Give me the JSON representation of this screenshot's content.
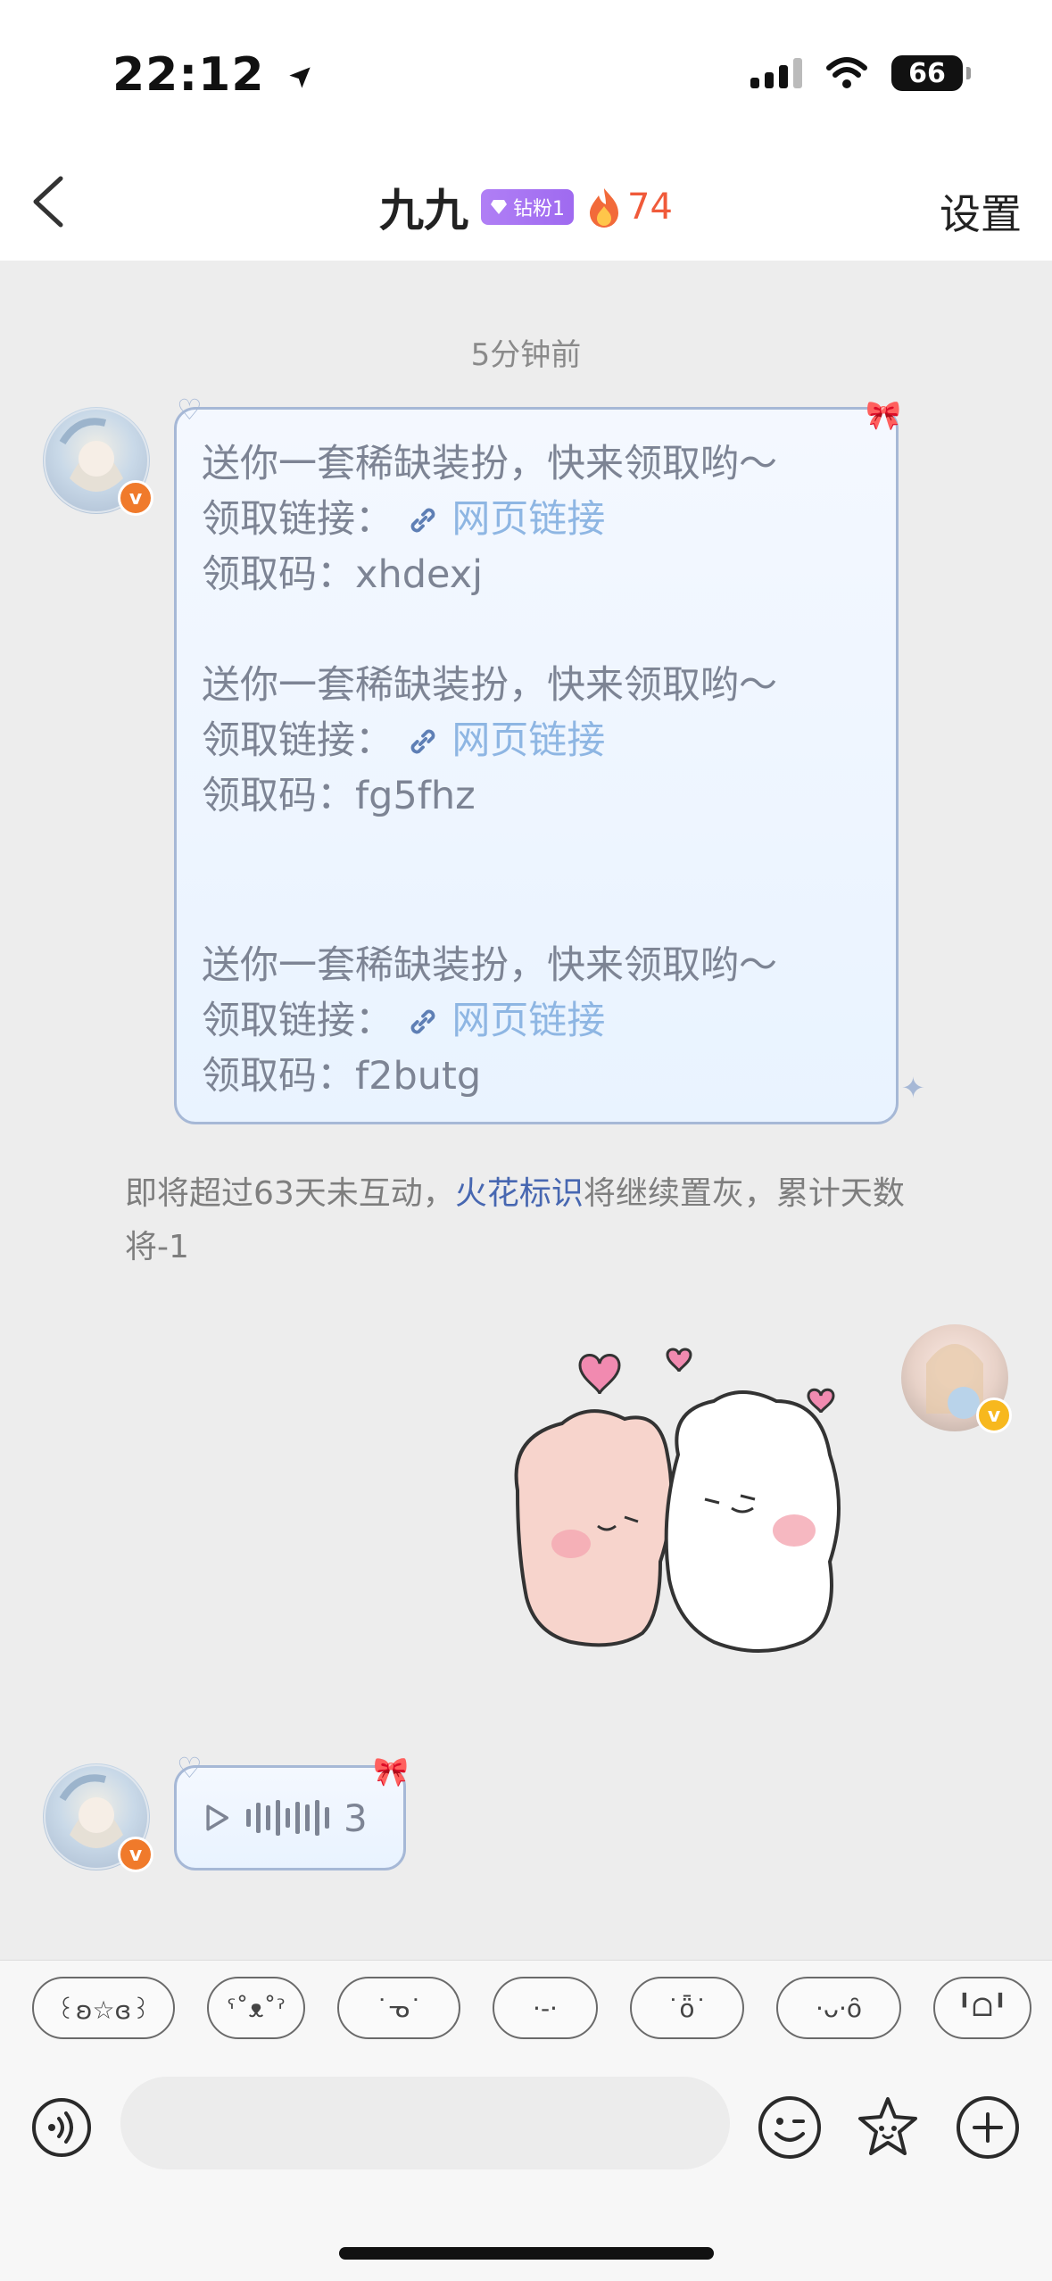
{
  "status_bar": {
    "time": "22:12",
    "battery": "66"
  },
  "header": {
    "name": "九九",
    "badge": "钻粉1",
    "fire_count": "74",
    "settings_label": "设置"
  },
  "chat": {
    "time_label": "5分钟前",
    "bubble_lines": {
      "l1": "送你一套稀缺装扮，快来领取哟～",
      "l2_prefix": "领取链接：",
      "l2_link": "网页链接",
      "l3": "领取码：xhdexj",
      "l4": "送你一套稀缺装扮，快来领取哟～",
      "l5_prefix": "领取链接：",
      "l5_link": "网页链接",
      "l6": "领取码：fg5fhz",
      "l7": "送你一套稀缺装扮，快来领取哟～",
      "l8_prefix": "领取链接：",
      "l8_link": "网页链接",
      "l9": "领取码：f2butg"
    },
    "notice": {
      "pre": "即将超过63天未互动，",
      "highlight": "火花标识",
      "post": "将继续置灰，累计天数将-1"
    },
    "voice_duration": "3"
  },
  "kaomoji": [
    "꒰ʚ☆ɞ꒱",
    "ˁ˚ᴥ˚ˀ",
    "˙ᓀ˙",
    "·-·",
    "˙ȫ˙",
    "·ᴗ·ȏ",
    "╹ᗝ╹"
  ],
  "input": {
    "placeholder": ""
  },
  "icons": {
    "back": "chevron-left-icon",
    "voice": "voice-icon",
    "emoji": "emoji-icon",
    "star": "star-face-icon",
    "add": "plus-icon"
  },
  "colors": {
    "accent_link": "#8eb6e3",
    "highlight": "#4767b1",
    "fire": "#f05a3a",
    "badge": "#a874f2"
  }
}
